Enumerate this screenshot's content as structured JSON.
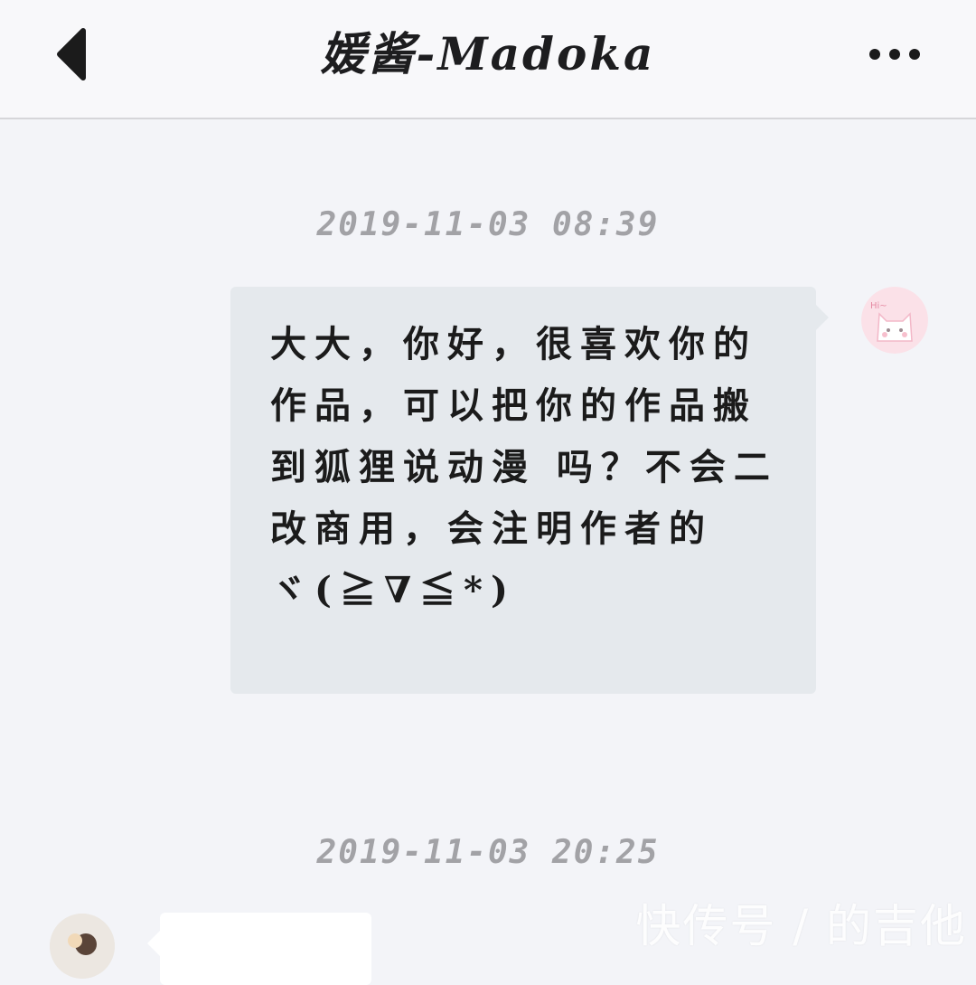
{
  "header": {
    "title": "媛酱-Madoka",
    "back_icon": "chevron-left-icon",
    "more_icon": "more-horizontal-icon"
  },
  "messages": [
    {
      "timestamp": "2019-11-03 08:39",
      "direction": "outgoing",
      "text": "大大，你好，很喜欢你的作品，可以把你的作品搬到狐狸说动漫 吗？不会二改商用，会注明作者的\nヾ(≧∇≦*)",
      "avatar_icon": "cat-avatar-icon"
    },
    {
      "timestamp": "2019-11-03 20:25",
      "direction": "incoming",
      "text": "",
      "avatar_icon": "user-avatar-icon"
    }
  ],
  "watermark": "快传号 / 的吉他",
  "colors": {
    "background": "#f3f4f8",
    "header_bg": "#f8f8fa",
    "outgoing_bubble": "#e5e9ed",
    "incoming_bubble": "#ffffff",
    "timestamp": "#a2a2a6"
  }
}
